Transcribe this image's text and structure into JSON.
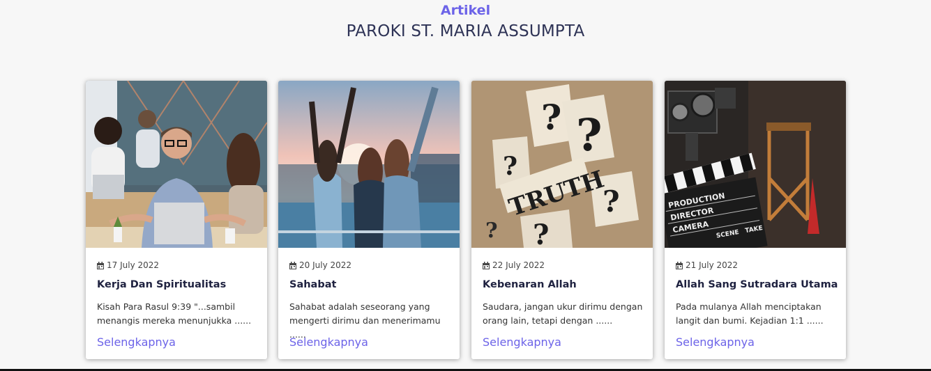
{
  "section": {
    "subtitle": "Artikel",
    "title": "PAROKI ST. MARIA ASSUMPTA"
  },
  "articles": [
    {
      "date": "17 July 2022",
      "title": "Kerja Dan Spiritualitas",
      "excerpt": "Kisah Para Rasul 9:39 \"...sambil menangis mereka menunjukka ......",
      "link": "Selengkapnya",
      "image_icon": "office-meditation-photo"
    },
    {
      "date": "20 July 2022",
      "title": "Sahabat",
      "excerpt": "Sahabat adalah seseorang yang mengerti dirimu dan menerimamu ......",
      "link": "Selengkapnya",
      "image_icon": "friends-sunset-photo"
    },
    {
      "date": "22 July 2022",
      "title": "Kebenaran Allah",
      "excerpt": "Saudara, jangan ukur dirimu dengan orang lain, tetapi dengan ......",
      "link": "Selengkapnya",
      "image_icon": "truth-question-marks-photo"
    },
    {
      "date": "21 July 2022",
      "title": "Allah Sang Sutradara Utama",
      "excerpt": "Pada mulanya Allah menciptakan langit dan bumi. Kejadian 1:1 ......",
      "link": "Selengkapnya",
      "image_icon": "film-clapperboard-photo"
    }
  ],
  "image_text": {
    "truth": "TRUTH",
    "clapper_lines": [
      "PRODUCTION",
      "DIRECTOR",
      "CAMERA",
      "SCENE",
      "TAKE"
    ]
  },
  "colors": {
    "accent": "#6c63e8",
    "title": "#2e3356"
  }
}
